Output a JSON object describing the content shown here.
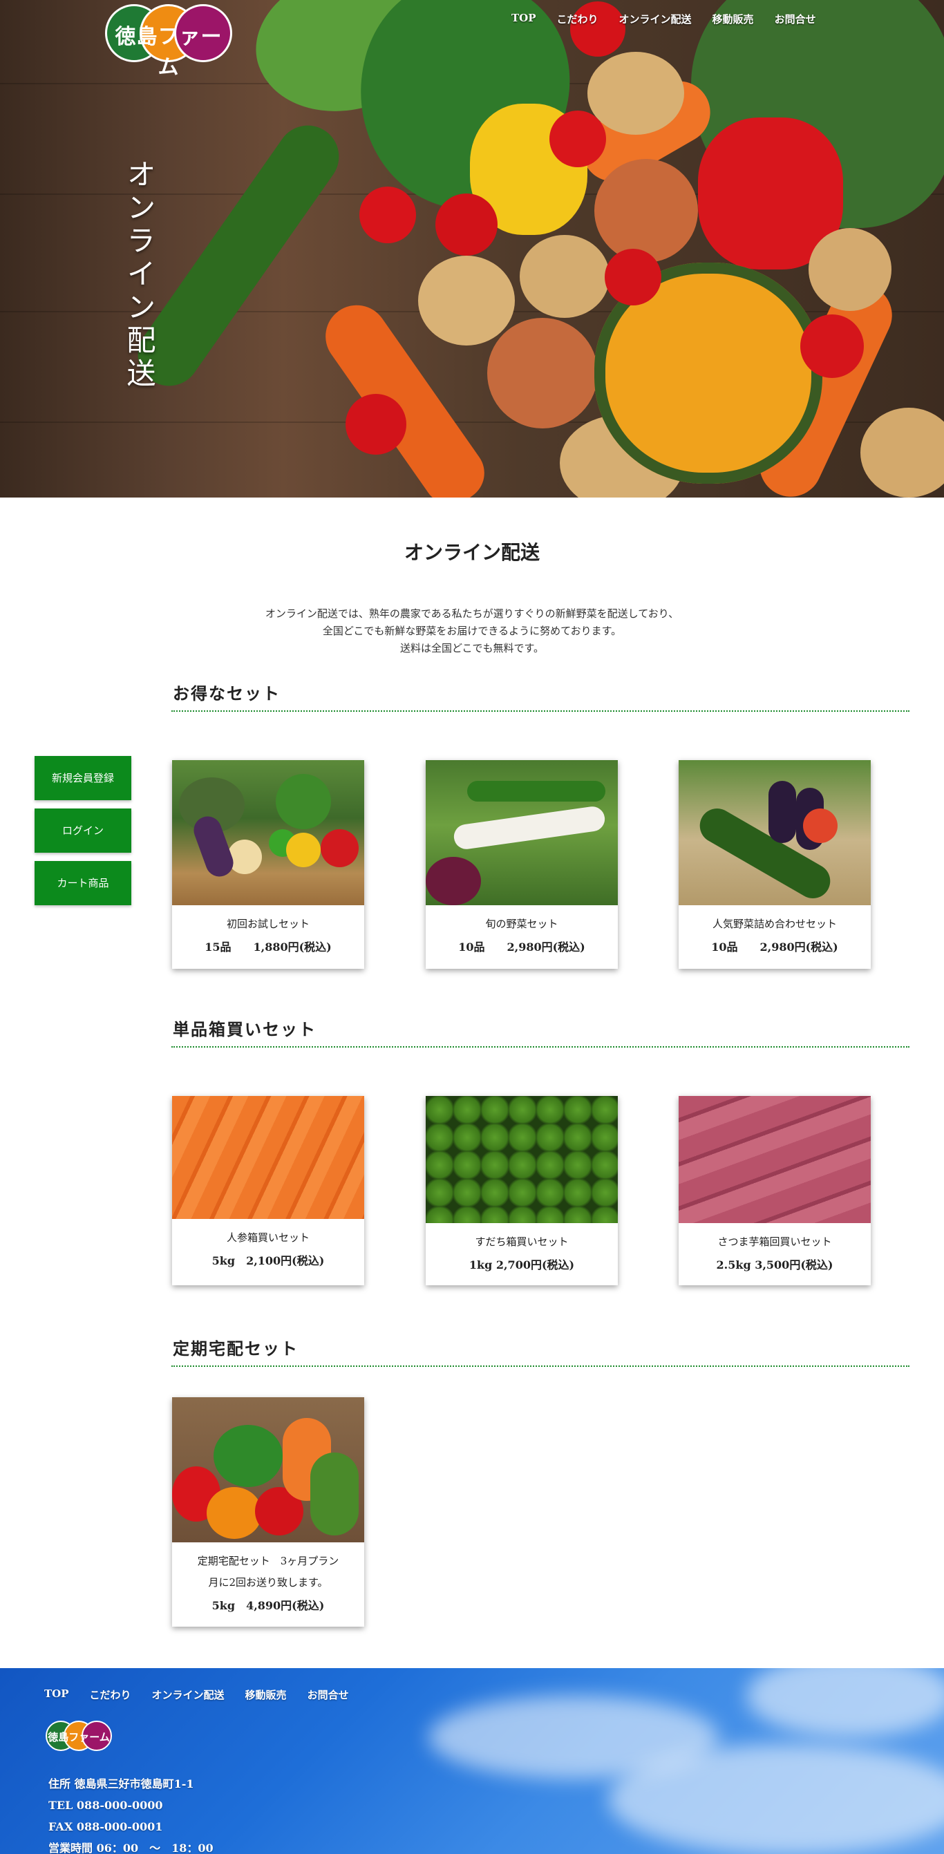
{
  "brand": {
    "name": "徳島ファーム",
    "colors": [
      "#1f7a34",
      "#ef8c12",
      "#9c1568"
    ]
  },
  "nav": [
    "TOP",
    "こだわり",
    "オンライン配送",
    "移動販売",
    "お問合せ"
  ],
  "hero": {
    "title": "オンライン配送"
  },
  "main": {
    "heading": "オンライン配送",
    "intro": [
      "オンライン配送では、熟年の農家である私たちが選りすぐりの新鮮野菜を配送しており、",
      "全国どこでも新鮮な野菜をお届けできるように努めております。",
      "送料は全国どこでも無料です。"
    ]
  },
  "sidebar": {
    "buttons": [
      "新規会員登録",
      "ログイン",
      "カート商品"
    ]
  },
  "sections": [
    {
      "title": "お得なセット",
      "products": [
        {
          "name": "初回お試しセット",
          "price": "15品　　1,880円(税込)",
          "image": "veg-basket"
        },
        {
          "name": "旬の野菜セット",
          "price": "10品　　2,980円(税込)",
          "image": "radish-greens"
        },
        {
          "name": "人気野菜詰め合わせセット",
          "price": "10品　　2,980円(税込)",
          "image": "cucumber-eggplant"
        }
      ]
    },
    {
      "title": "単品箱買いセット",
      "products": [
        {
          "name": "人参箱買いセット",
          "price": "5kg　2,100円(税込)",
          "image": "carrots"
        },
        {
          "name": "すだち箱買いセット",
          "price": "1kg 2,700円(税込)",
          "image": "sudachi"
        },
        {
          "name": "さつま芋箱回買いセット",
          "price": "2.5kg 3,500円(税込)",
          "image": "sweet-potatoes"
        }
      ]
    },
    {
      "title": "定期宅配セット",
      "products": [
        {
          "name": "定期宅配セット　3ヶ月プラン",
          "note": "月に2回お送り致します。",
          "price": "5kg　4,890円(税込)",
          "image": "mixed-veg"
        }
      ]
    }
  ],
  "footer": {
    "nav": [
      "TOP",
      "こだわり",
      "オンライン配送",
      "移動販売",
      "お問合せ"
    ],
    "brand": "徳島ファーム",
    "address": "住所 徳島県三好市徳島町1-1",
    "tel": "TEL 088-000-0000",
    "fax": "FAX 088-000-0001",
    "hours": "営業時間 06：00　〜　18：00"
  }
}
